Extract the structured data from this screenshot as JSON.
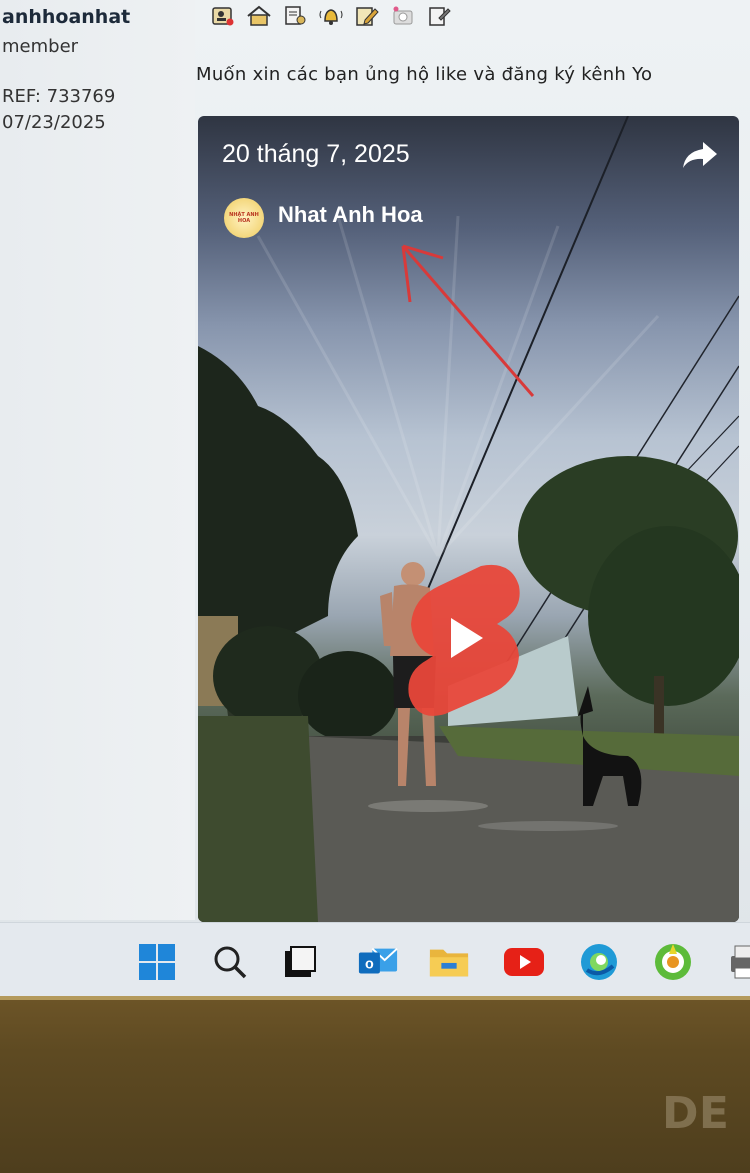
{
  "profile": {
    "username": "anhhoanhat",
    "role": "member",
    "ref": "REF: 733769",
    "date": "07/23/2025"
  },
  "toolbar": {
    "icons": [
      "profile-icon",
      "home-icon",
      "document-icon",
      "bell-icon",
      "edit-icon",
      "camera-icon",
      "note-icon"
    ]
  },
  "post": {
    "text": "Muốn xin các bạn ủng hộ like và đăng ký kênh Yo"
  },
  "video": {
    "date": "20 tháng 7, 2025",
    "channel_name": "Nhat Anh Hoa",
    "logo_text": "NHẬT ANH HOA",
    "accent_color": "#e8473a"
  },
  "taskbar": {
    "apps": [
      "windows-start-icon",
      "search-icon",
      "task-view-icon",
      "outlook-icon",
      "file-explorer-icon",
      "youtube-icon",
      "edge-icon",
      "app-icon",
      "printer-icon"
    ]
  },
  "bezel": {
    "brand": "DELL"
  }
}
